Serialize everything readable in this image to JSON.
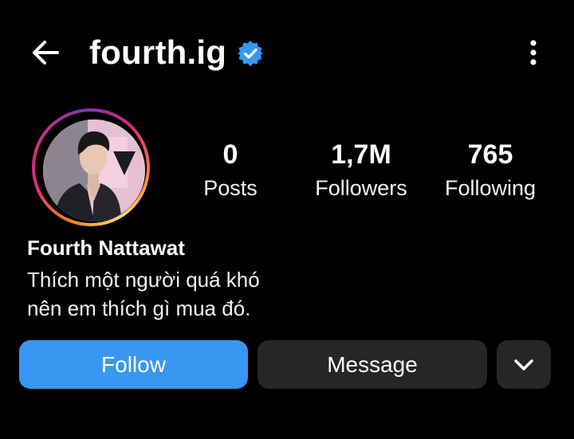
{
  "header": {
    "username": "fourth.ig",
    "back_icon": "arrow-left-icon",
    "verified_icon": "verified-badge-icon",
    "more_icon": "more-vertical-icon"
  },
  "profile": {
    "avatar_icon": "profile-avatar",
    "display_name": "Fourth Nattawat",
    "bio_line1": "Thích một người quá khó",
    "bio_line2": "nên em thích gì mua đó."
  },
  "stats": [
    {
      "value": "0",
      "label": "Posts"
    },
    {
      "value": "1,7M",
      "label": "Followers"
    },
    {
      "value": "765",
      "label": "Following"
    }
  ],
  "actions": {
    "follow_label": "Follow",
    "message_label": "Message",
    "suggest_icon": "chevron-down-icon"
  },
  "colors": {
    "background": "#000000",
    "follow": "#3897f0",
    "secondary_button": "#262626",
    "verified": "#3897f0"
  }
}
